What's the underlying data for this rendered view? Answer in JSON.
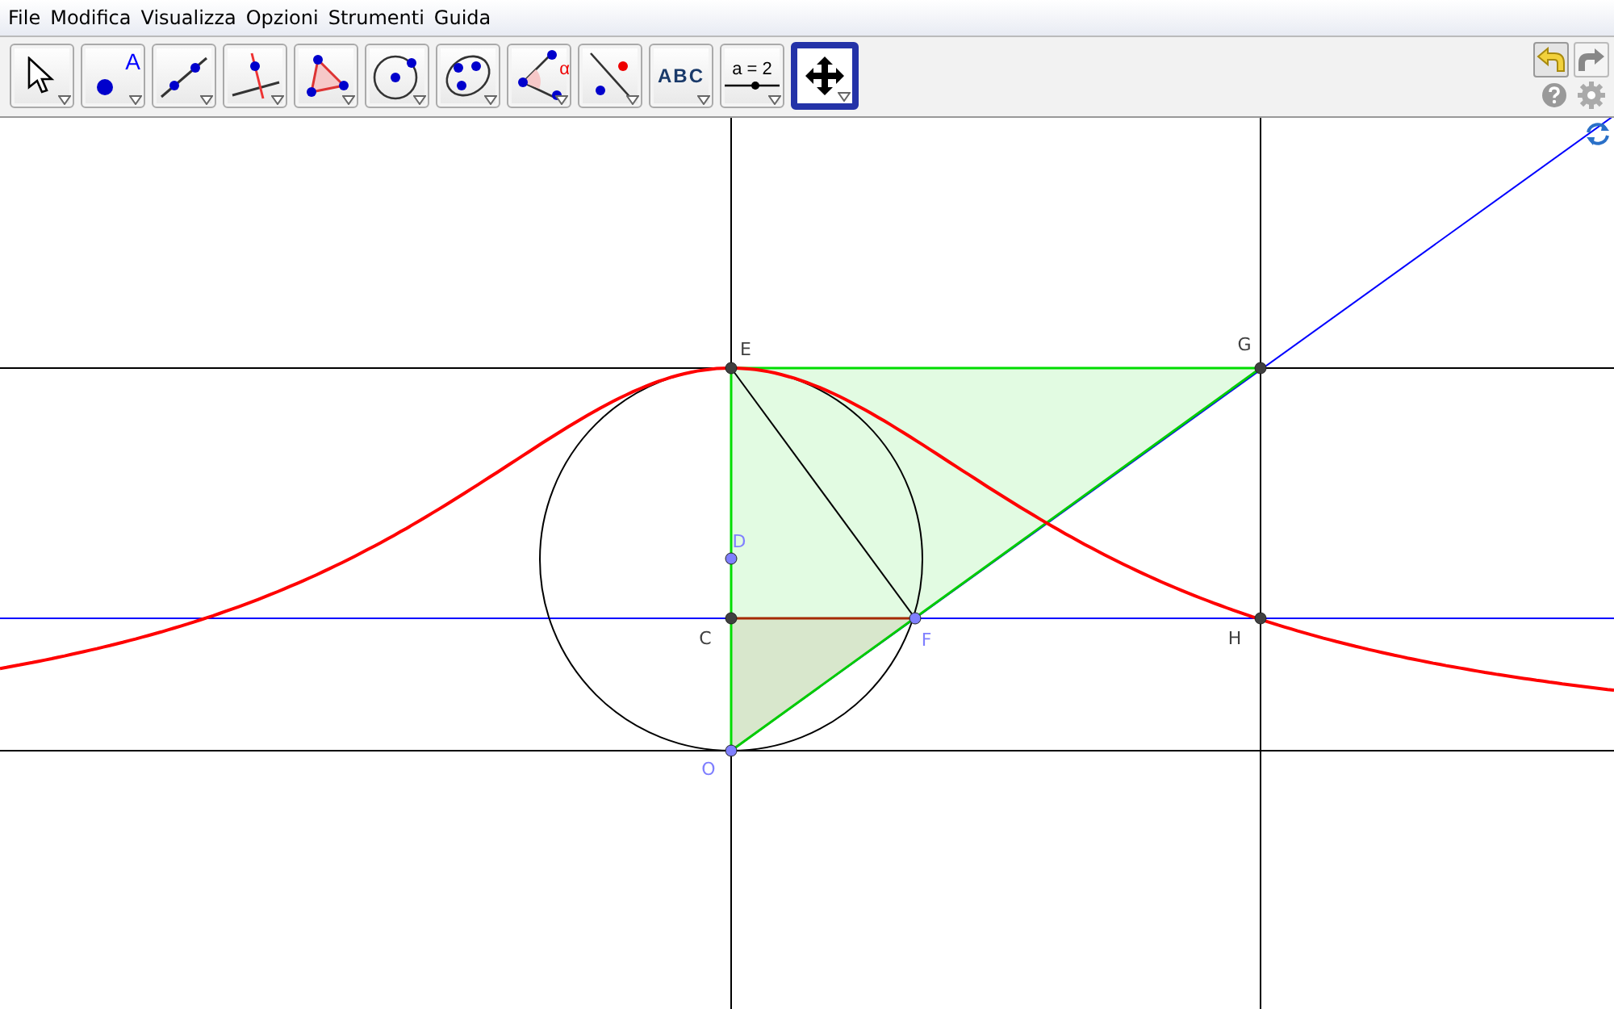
{
  "menu": [
    "File",
    "Modifica",
    "Visualizza",
    "Opzioni",
    "Strumenti",
    "Guida"
  ],
  "tools": [
    {
      "kind": "move",
      "selected": false
    },
    {
      "kind": "point",
      "label": "A",
      "selected": false
    },
    {
      "kind": "line",
      "selected": false
    },
    {
      "kind": "perpendicular",
      "selected": false
    },
    {
      "kind": "polygon",
      "selected": false
    },
    {
      "kind": "circle",
      "selected": false
    },
    {
      "kind": "conic",
      "selected": false
    },
    {
      "kind": "angle",
      "label": "α",
      "selected": false
    },
    {
      "kind": "reflect",
      "selected": false
    },
    {
      "kind": "text",
      "label": "ABC",
      "selected": false
    },
    {
      "kind": "slider",
      "label": "a = 2",
      "selected": false
    },
    {
      "kind": "pan",
      "selected": true
    }
  ],
  "points": [
    {
      "name": "E",
      "color": "#404040"
    },
    {
      "name": "G",
      "color": "#404040"
    },
    {
      "name": "D",
      "color": "#7f7fff"
    },
    {
      "name": "C",
      "color": "#404040"
    },
    {
      "name": "F",
      "color": "#7f7fff"
    },
    {
      "name": "H",
      "color": "#404040"
    },
    {
      "name": "O",
      "color": "#7f7fff"
    }
  ]
}
